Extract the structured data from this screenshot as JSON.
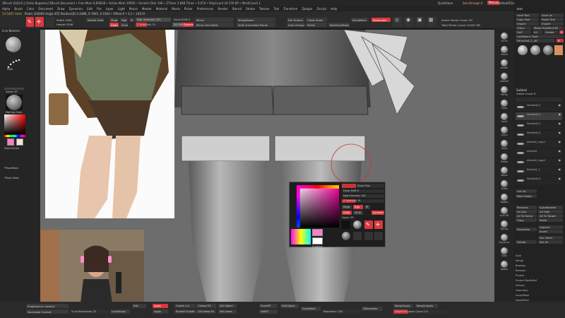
{
  "titlebar": {
    "left_text": "ZBrush 2024.0 | [Anita Bogenka]  ZBrush Document  • Free Mem 6,856GB • Active Mem 10950 • Scratch Disk 106 • ZTimer 3.668 Timer • 0.074 • PolyCount 24.576 KP • MeshCount 1",
    "quicksave": "QuickSave",
    "see_through": "See-through 0",
    "menus": "Menus",
    "default_zscript": "DefaultZScript"
  },
  "menubar": {
    "items": [
      "Alpha",
      "Brush",
      "Color",
      "Document",
      "Draw",
      "Dynamics",
      "Edit",
      "File",
      "Layer",
      "Light",
      "Macro",
      "Marker",
      "Material",
      "Movie",
      "Picker",
      "Preferences",
      "Render",
      "Stencil",
      "Stroke",
      "Texture",
      "Tool",
      "Transform",
      "Zplugin",
      "Zscript",
      "Help"
    ]
  },
  "toolbar": {
    "coords": "13.5467 Units",
    "pixels": "Pixels 104060 Angle 455 Position(B) 0.2486, 0.7845, 0.1583 • Offset 0 • S,1 • 100 000",
    "width_label": "Width 4465",
    "height_label": "Height 5348",
    "delete_hints": "Delete Intern",
    "mrgb": "Mrgb",
    "rgb": "Rgb",
    "m": "M",
    "zadd": "Zadd",
    "zsub": "Zsub",
    "zcut": "Zcut",
    "focal_shift": "Focal Shift 0",
    "draw_size": "Draw Size 70",
    "rgb_intensity": "Rgb Intensity 100",
    "z_intensity": "Z Intensity 31",
    "dynamic": "Dynamic",
    "mirror": "Mirror",
    "mirror_and_weld": "Mirror And Weld",
    "merge_down": "MergeDown",
    "split_hidden": "Split Unmasked Points",
    "del_hidden": "Del Hidden",
    "close_holes": "Close Holes",
    "auto_groups": "Auto Groups",
    "polish": "Polish",
    "backface_mask": "BackfaceMask",
    "dynamesh": "DynaMesh",
    "resolution": "Resolution",
    "active_points": "Active Points Count 1M",
    "total_points": "Total Points Count 13,657 Mil",
    "zoom_values": "50.78834"
  },
  "leftshelf": {
    "live_boolean": "Live Boolean",
    "brush_name": "Move",
    "stroke_name": "Dots",
    "alpha_name": "Alpha Off",
    "texture_name": "Texture Off",
    "material_name": "MatCap Gray",
    "gradient": "Gradient",
    "switch_color": "SwitchColor",
    "mesh_fill": "Alternate",
    "ppad1": "TPoseMesh",
    "ppad2": "TPose Stats"
  },
  "rightshelf": {
    "items": [
      "Scroll",
      "Zoom",
      "Actual",
      "AAHalf",
      "Persp",
      "Floor",
      "Local",
      "LSym",
      "Gxyz",
      "Frame",
      "Move",
      "Scale",
      "Rotate",
      "Line Fill",
      "Transp",
      "Dynamic",
      "Solo",
      "Xpose"
    ]
  },
  "rightpanel": {
    "title": "Tool",
    "load_tool": "Load Tool",
    "save_as": "Save As",
    "copy_tool": "Copy Tool",
    "paste_tool": "Paste Tool",
    "import": "Import",
    "export": "Export",
    "clone": "Clone",
    "make_polymesh": "Make PolyMesh3D",
    "goz": "GoZ",
    "all": "All",
    "visible": "Visible",
    "r": "R",
    "lightbox_tools": "Lightbox ▸ Tools",
    "tool_name": "Ferris4x6_1_48",
    "r_label": "R",
    "subtool": "Subtool",
    "visible_count": "Visible Count 8",
    "subtools": [
      "Ferris4x6_1",
      "Ferris4x6_2",
      "Ferris4x6_3",
      "Ferris4x6_4",
      "extract2_copy1",
      "extract3",
      "extract2_copy2",
      "Extract1_1",
      "Ferris4x6_5"
    ],
    "list_all": "List All",
    "auto_reorder": "Auto Reorder",
    "new_folder": "New Folder",
    "rename": "Rename",
    "auto_reorder2": "AutoReorder",
    "all_low": "All Low",
    "all_high": "All High",
    "all_to_home": "All To Home",
    "all_to_target": "All To Target",
    "copy": "Copy",
    "paste": "Paste",
    "duplicate": "Duplicate",
    "append": "Append",
    "insert": "Insert",
    "delete": "Delete",
    "del_other": "Del Other",
    "del_all": "Del All",
    "split": "Split",
    "merge": "Merge",
    "boolean": "Boolean",
    "remesh": "Remesh",
    "project": "Project",
    "extract": "Extract",
    "split_item": "Split",
    "merge_item": "Merge",
    "bevel_pro": "Bevel Pro",
    "align": "Align",
    "distribute": "Distribute",
    "remesh2": "Remesh",
    "project2": "Project",
    "project_bas_relief": "Project BasRelief",
    "extract2": "Extract",
    "geometry": "Geometry",
    "arraymesh": "ArrayMesh",
    "nanomesh": "NanoMesh",
    "thick_skin": "Thick Skin",
    "layers": "Layers",
    "fibermesh": "FiberMesh",
    "geometry_hd": "Geometry HD",
    "preview": "Preview",
    "surface": "Surface",
    "deformation": "Deformation",
    "masking": "Masking",
    "visibility": "Visibility",
    "polygroups": "Polygroups",
    "contact": "Contact",
    "morph_target": "Morph Target",
    "polypaint": "Polypaint",
    "uv_map": "UV Map",
    "texture_map": "Texture Map",
    "displacement": "Displacement Map",
    "normal_map": "Normal Map",
    "vector_disp": "Vector Displacement Map",
    "display_properties": "Display Properties",
    "unified_skin": "Unified Skin",
    "initialize": "Initialize",
    "import2": "Import",
    "export2": "Export",
    "redshift": "Redshift Properties"
  },
  "popup": {
    "rgb_label": "Rgb",
    "rgb_intensity": "Rgb Intensity 100",
    "z_intensity": "Z Intensity 31",
    "focal_shift": "Focal Shift 0",
    "draw_size": "Draw Size",
    "dynamic": "Dynamic",
    "alpha": "Alpha Off",
    "zadd": "Zadd",
    "zsub": "Zsub",
    "mrgb": "Mrgb",
    "m": "M",
    "gradient": "Gradient",
    "switch_color": "SwitchColor",
    "color_swatch_main": "#ff7cc8",
    "color_swatch_secondary": "#ffffff"
  },
  "bottombar": {
    "progressive_content": "Progressive Content",
    "decimate_current": "Decimate Current",
    "pct_decimation": "% of decimation 20",
    "lazy_mouse": "LazyMouse",
    "edit_left": "Edit",
    "apply": "Apply",
    "smooth_subdiv": "Smooth Subdiv",
    "create_lv": "Create Lv1",
    "crease_pg": "Crease PG",
    "uncrease_all": "UnCrease All",
    "del_higher": "Del Higher",
    "del_lower": "Del Lower",
    "store_mt": "StoreMT",
    "del_mt": "DelMT",
    "edit_object": "EditObject",
    "dynamesh": "DynaMesh",
    "resolution": "Resolution 128",
    "zremesher": "ZRemesher",
    "keep_groups": "KeepGroups",
    "keep_creases": "KeepCreases",
    "target_polygons": "Target Polygons Count 0.5"
  },
  "colors": {
    "accent": "#d8383e",
    "panel": "#2b2b2b",
    "canvas": "#6e6e6e"
  }
}
